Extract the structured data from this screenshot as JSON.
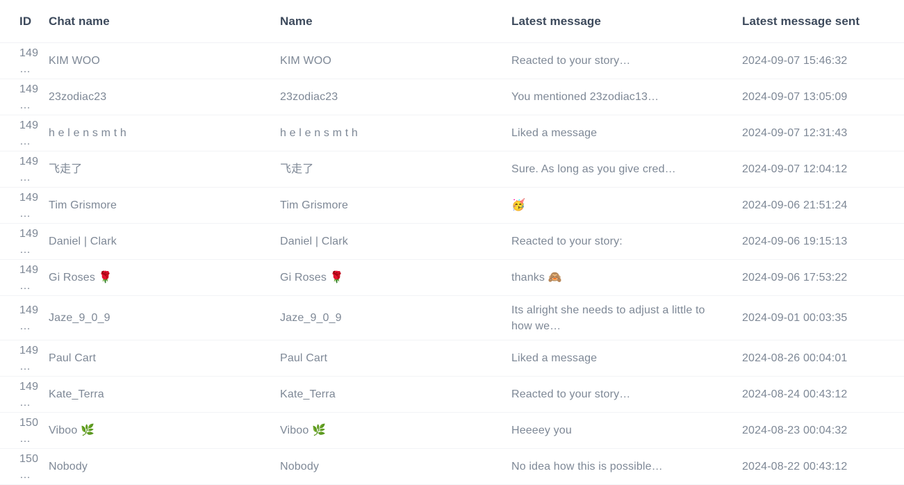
{
  "table": {
    "columns": [
      {
        "key": "id",
        "label": "ID"
      },
      {
        "key": "chatname",
        "label": "Chat name"
      },
      {
        "key": "name",
        "label": "Name"
      },
      {
        "key": "message",
        "label": "Latest message"
      },
      {
        "key": "sent",
        "label": "Latest message sent"
      }
    ],
    "rows": [
      {
        "id": "149…",
        "chatname": "KIM WOO",
        "name": "KIM WOO",
        "message": "Reacted to your story…",
        "sent": "2024-09-07 15:46:32",
        "tall": false
      },
      {
        "id": "149…",
        "chatname": "23zodiac23",
        "name": "23zodiac23",
        "message": "You mentioned 23zodiac13…",
        "sent": "2024-09-07 13:05:09",
        "tall": false
      },
      {
        "id": "149…",
        "chatname": "h e l e n s m t h",
        "name": "h e l e n s m t h",
        "message": "Liked a message",
        "sent": "2024-09-07 12:31:43",
        "tall": false
      },
      {
        "id": "149…",
        "chatname": "飞走了",
        "name": "飞走了",
        "message": "Sure. As long as you give cred…",
        "sent": "2024-09-07 12:04:12",
        "tall": false
      },
      {
        "id": "149…",
        "chatname": "Tim Grismore",
        "name": "Tim Grismore",
        "message": "🥳",
        "sent": "2024-09-06 21:51:24",
        "tall": false
      },
      {
        "id": "149…",
        "chatname": "Daniel | Clark",
        "name": "Daniel | Clark",
        "message": "Reacted to your story:",
        "sent": "2024-09-06 19:15:13",
        "tall": false
      },
      {
        "id": "149…",
        "chatname": "Gi Roses 🌹",
        "name": "Gi Roses 🌹",
        "message": "thanks 🙈",
        "sent": "2024-09-06 17:53:22",
        "tall": false
      },
      {
        "id": "149…",
        "chatname": "Jaze_9_0_9",
        "name": "Jaze_9_0_9",
        "message": "Its alright she needs to adjust a little to how we…",
        "sent": "2024-09-01 00:03:35",
        "tall": true
      },
      {
        "id": "149…",
        "chatname": "Paul Cart",
        "name": "Paul Cart",
        "message": "Liked a message",
        "sent": "2024-08-26 00:04:01",
        "tall": false
      },
      {
        "id": "149…",
        "chatname": "Kate_Terra",
        "name": "Kate_Terra",
        "message": "Reacted to your story…",
        "sent": "2024-08-24 00:43:12",
        "tall": false
      },
      {
        "id": "150…",
        "chatname": "Viboo 🌿",
        "name": "Viboo 🌿",
        "message": "Heeeey you",
        "sent": "2024-08-23 00:04:32",
        "tall": false
      },
      {
        "id": "150…",
        "chatname": "Nobody",
        "name": "Nobody",
        "message": "No idea how this is possible…",
        "sent": "2024-08-22 00:43:12",
        "tall": false
      }
    ]
  },
  "colors": {
    "header_text": "#3d4a5c",
    "body_text": "#7e8896",
    "divider": "#f2f3f6",
    "background": "#ffffff"
  }
}
